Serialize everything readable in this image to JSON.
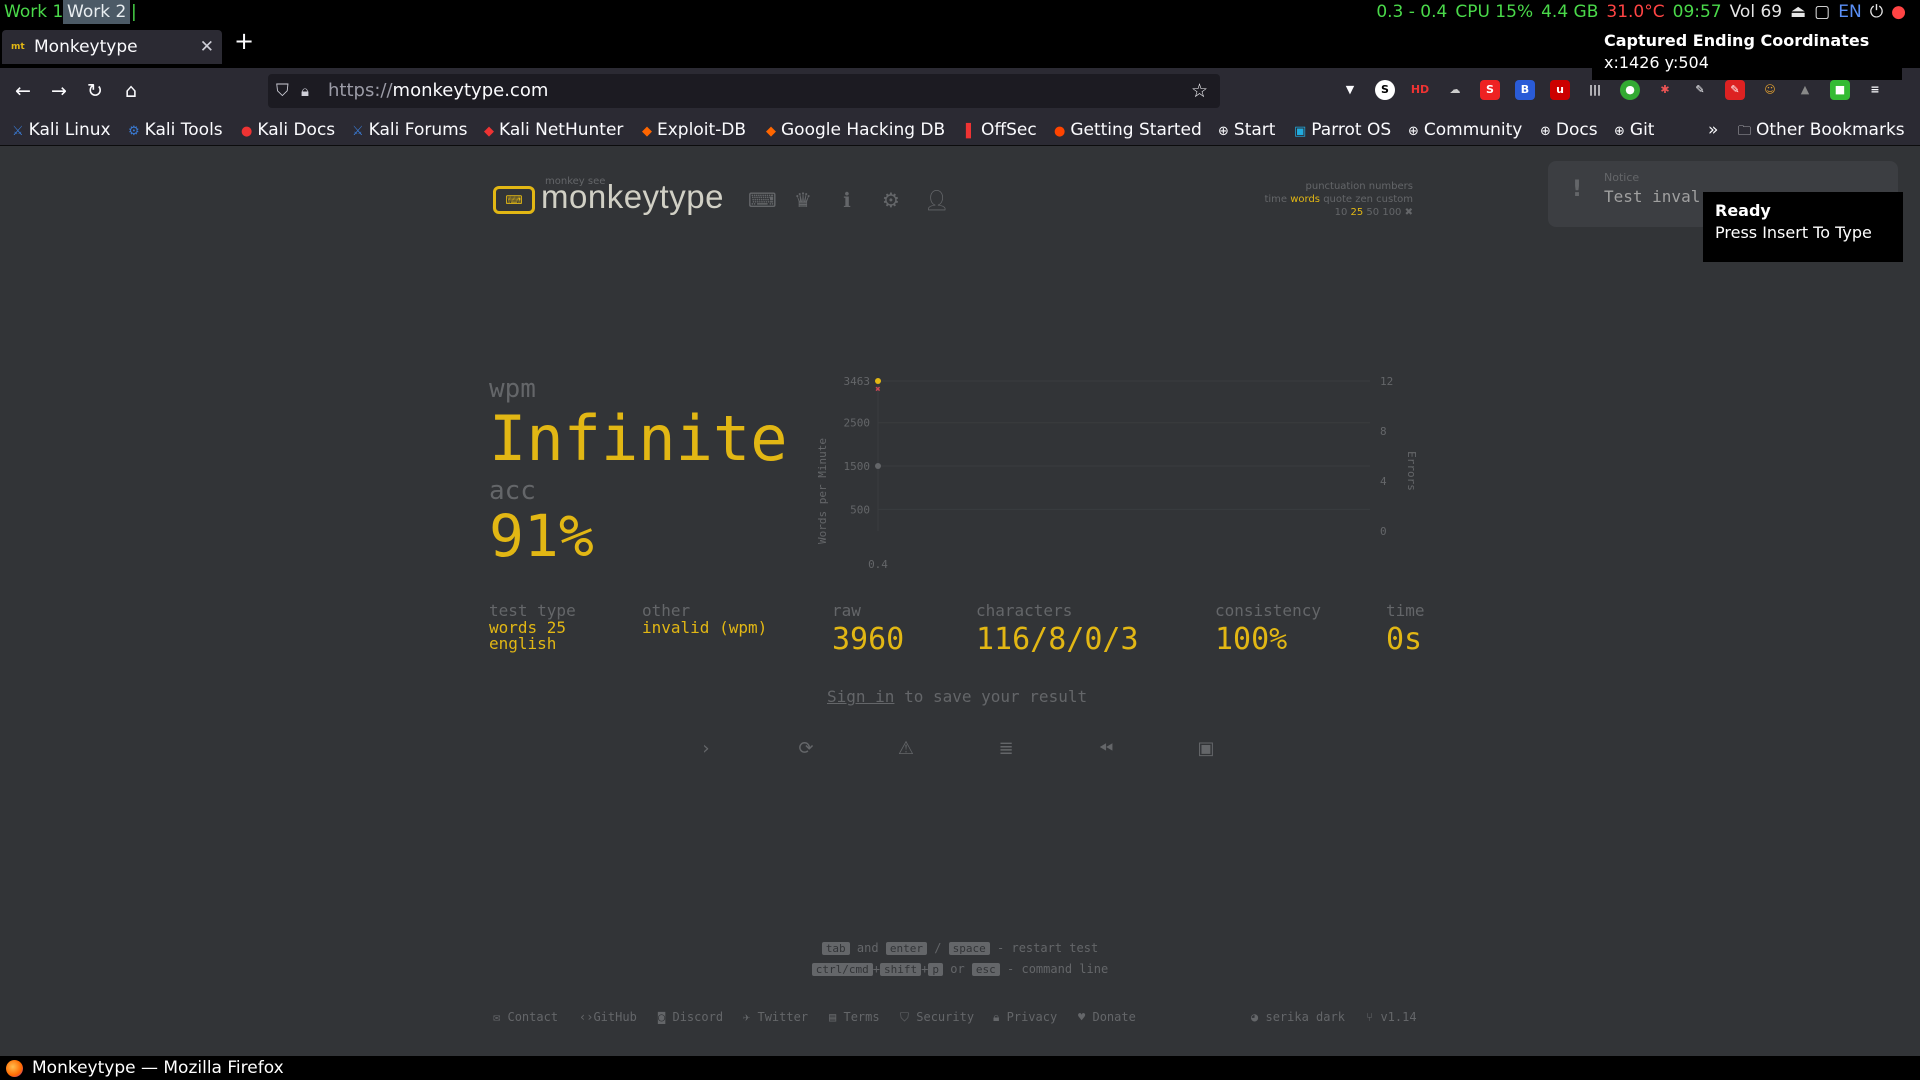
{
  "system_bar": {
    "workspace_1": "Work 1",
    "workspace_2": "Work 2",
    "load": "0.3 - 0.4",
    "cpu": "CPU 15%",
    "mem": "4.4 GB",
    "temp": "31.0°C",
    "clock": "09:57",
    "volume": "Vol 69",
    "lang": "EN"
  },
  "browser": {
    "tab_title": "Monkeytype",
    "favicon_text": "mt",
    "url_scheme": "https://",
    "url_host": "monkeytype.com",
    "window_title": "Monkeytype — Mozilla Firefox",
    "bookmarks": [
      "Kali Linux",
      "Kali Tools",
      "Kali Docs",
      "Kali Forums",
      "Kali NetHunter",
      "Exploit-DB",
      "Google Hacking DB",
      "OffSec",
      "Getting Started",
      "Start",
      "Parrot OS",
      "Community",
      "Docs",
      "Git"
    ],
    "other_bookmarks": "Other Bookmarks"
  },
  "overlay": {
    "coords_title": "Captured Ending Coordinates",
    "coords_value": "x:1426 y:504",
    "tooltip_title": "Ready",
    "tooltip_msg": "Press Insert To Type"
  },
  "header": {
    "logo_sub": "monkey see",
    "logo_text": "monkeytype",
    "config_line1": "punctuation numbers",
    "config_line2_a": "time ",
    "config_line2_hl": "words",
    "config_line2_b": " quote zen custom",
    "config_line3_a": "10 ",
    "config_line3_hl": "25",
    "config_line3_b": " 50 100"
  },
  "notice": {
    "title": "Notice",
    "message": "Test inval"
  },
  "result": {
    "wpm_label": "wpm",
    "wpm_value": "Infinite",
    "acc_label": "acc",
    "acc_value": "91%",
    "test_type_label": "test type",
    "test_type_value1": "words 25",
    "test_type_value2": "english",
    "other_label": "other",
    "other_value": "invalid (wpm)",
    "raw_label": "raw",
    "raw_value": "3960",
    "characters_label": "characters",
    "characters_value": "116/8/0/3",
    "consistency_label": "consistency",
    "consistency_value": "100%",
    "time_label": "time",
    "time_value": "0s",
    "signin_link": "Sign in",
    "signin_rest": " to save your result"
  },
  "chart_data": {
    "type": "line",
    "x": [
      0.4
    ],
    "series": [],
    "ylabel": "Words per Minute",
    "y2label": "Errors",
    "y_ticks": [
      "3463",
      "2500",
      "1500",
      "500"
    ],
    "y2_ticks": [
      "12",
      "8",
      "4",
      "0"
    ],
    "x_ticks": [
      "0.4"
    ],
    "points": [
      {
        "x": 0.4,
        "y": 3463,
        "color": "#e2b714"
      },
      {
        "x": 0.4,
        "y": 3300,
        "color": "#ca4754",
        "marker": "x"
      },
      {
        "x": 0.4,
        "y": 1500,
        "color": "#646669"
      }
    ]
  },
  "key_tips": {
    "tab": "tab",
    "and": "and",
    "enter": "enter",
    "slash": "/",
    "space": "space",
    "restart": "- restart test",
    "ctrlcmd": "ctrl/cmd",
    "shift": "shift",
    "p": "p",
    "or": "or",
    "esc": "esc",
    "cmdline": "- command line"
  },
  "footer": {
    "contact": "Contact",
    "github": "GitHub",
    "discord": "Discord",
    "twitter": "Twitter",
    "terms": "Terms",
    "security": "Security",
    "privacy": "Privacy",
    "donate": "Donate",
    "theme": "serika dark",
    "version": "v1.14"
  },
  "colors": {
    "bg": "#323437",
    "main": "#e2b714",
    "sub": "#646669",
    "text": "#d1d0c5",
    "error": "#ca4754"
  }
}
